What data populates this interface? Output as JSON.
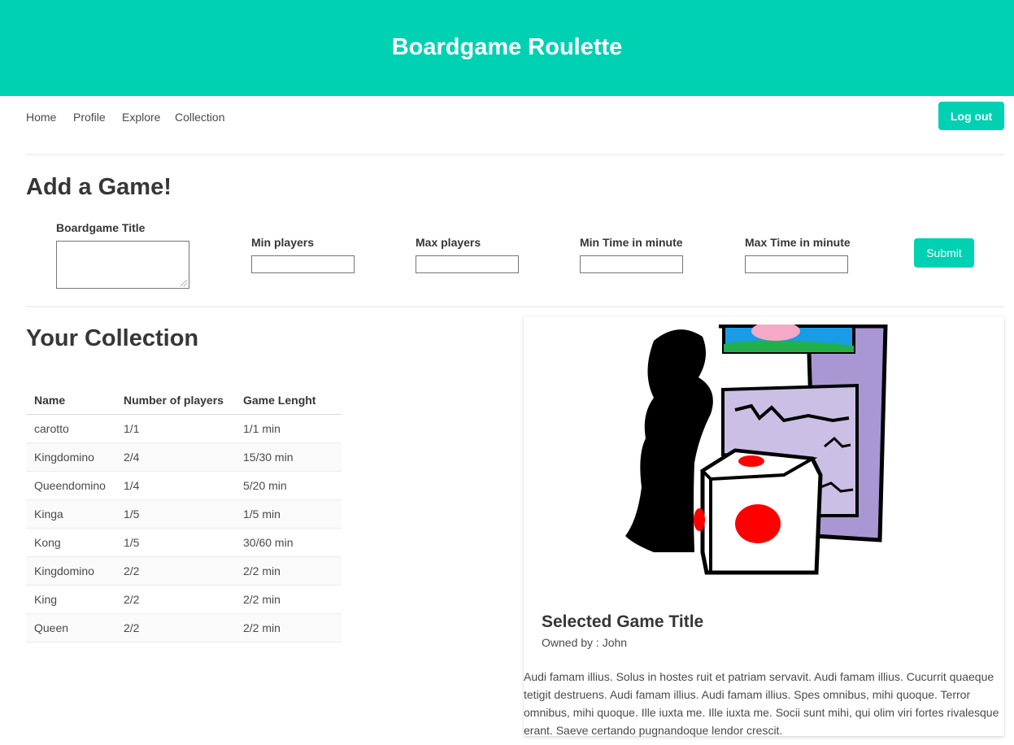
{
  "header": {
    "title": "Boardgame Roulette"
  },
  "nav": {
    "items": [
      "Home",
      "Profile",
      "Explore",
      "Collection"
    ],
    "logout_label": "Log out"
  },
  "add_game": {
    "title": "Add a Game!",
    "fields": {
      "boardgame_title": "Boardgame Title",
      "min_players": "Min players",
      "max_players": "Max players",
      "min_time": "Min Time in minute",
      "max_time": "Max Time in minute"
    },
    "values": {
      "boardgame_title": "",
      "min_players": "",
      "max_players": "",
      "min_time": "",
      "max_time": ""
    },
    "submit_label": "Submit"
  },
  "collection": {
    "title": "Your Collection",
    "columns": [
      "Name",
      "Number of players",
      "Game Lenght"
    ],
    "rows": [
      [
        "carotto",
        "1/1",
        "1/1 min"
      ],
      [
        "Kingdomino",
        "2/4",
        "15/30 min"
      ],
      [
        "Queendomino",
        "1/4",
        "5/20 min"
      ],
      [
        "Kinga",
        "1/5",
        "1/5 min"
      ],
      [
        "Kong",
        "1/5",
        "30/60 min"
      ],
      [
        "Kingdomino",
        "2/2",
        "2/2 min"
      ],
      [
        "King",
        "2/2",
        "2/2 min"
      ],
      [
        "Queen",
        "2/2",
        "2/2 min"
      ]
    ]
  },
  "selected_game": {
    "title": "Selected Game Title",
    "owner": "Owned by : John",
    "description": "Audi famam illius. Solus in hostes ruit et patriam servavit. Audi famam illius. Cucurrit quaeque tetigit destruens. Audi famam illius. Audi famam illius. Spes omnibus, mihi quoque. Terror omnibus, mihi quoque. Ille iuxta me. Ille iuxta me. Socii sunt mihi, qui olim viri fortes rivalesque erant. Saeve certando pugnandoque lendor crescit."
  },
  "colors": {
    "primary": "#00d1b2",
    "text": "#363636",
    "muted": "#4a4a4a"
  }
}
